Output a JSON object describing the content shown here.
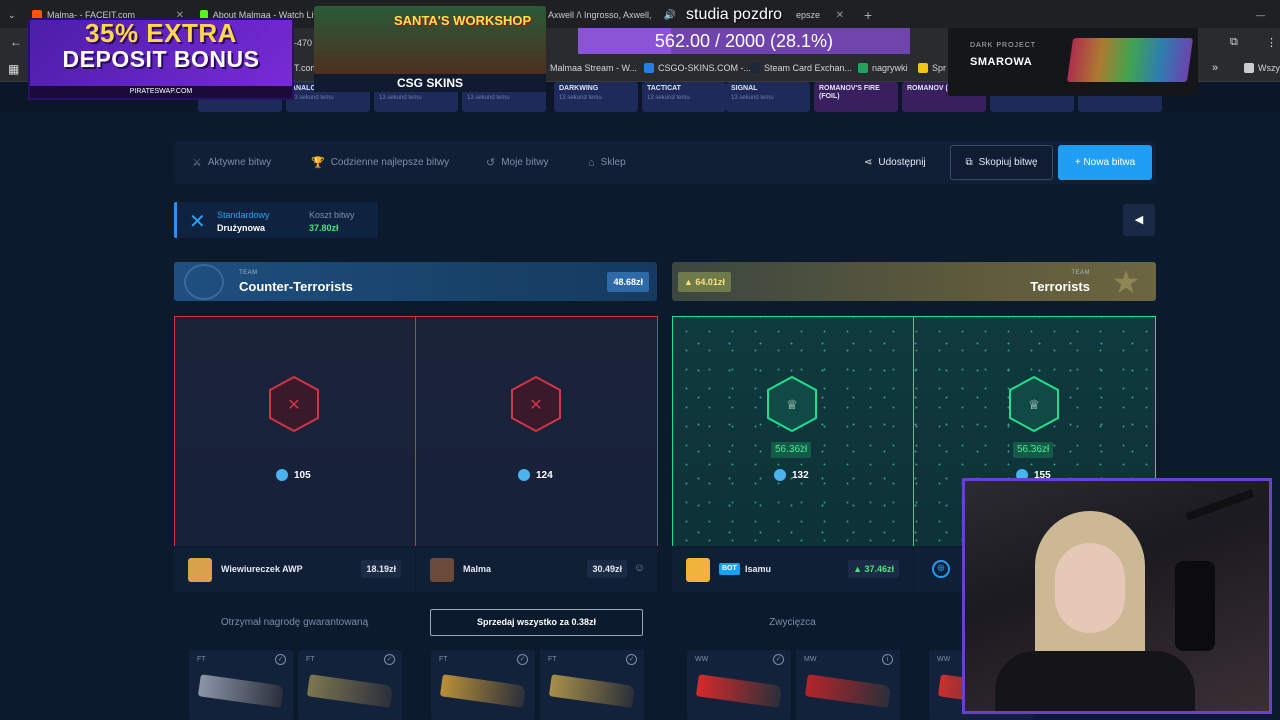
{
  "browser": {
    "tabs": [
      {
        "title": "Malma- - FACEIT.com",
        "color": "#ff5500"
      },
      {
        "title": "About Malmaa - Watch Liv",
        "color": "#53fc18"
      },
      {
        "title": "Axwell /\\ Ingrosso, Axwell,",
        "color": "#ff0000"
      },
      {
        "title": "epsze",
        "color": "#2a8ff0"
      }
    ],
    "url_partial": "T.com",
    "url_fragment": "-470",
    "bookmarks": [
      {
        "label": "Malmaa Stream - W..."
      },
      {
        "label": "CSGO-SKINS.COM -..."
      },
      {
        "label": "Steam Card Exchan..."
      },
      {
        "label": "nagrywki"
      },
      {
        "label": "Spr"
      },
      {
        "label": "Wszy"
      }
    ]
  },
  "overlay": {
    "promo_line1": "35% EXTRA",
    "promo_line2": "DEPOSIT BONUS",
    "promo_site": "PIRATESWAP.COM",
    "santa_title": "SANTA'S WORKSHOP",
    "sponsor": "CSG SKINS",
    "stream_title": "studia pozdro",
    "goal_text": "562.00 / 2000 (28.1%)",
    "goal_fraction": 0.281,
    "kb_brand": "DARK PROJECT",
    "kb_name": "SMAROWA"
  },
  "battle_strip": [
    {
      "name": "",
      "sub": "13 sekund temu"
    },
    {
      "name": "ANALOG INPUT",
      "sub": "13 sekund temu"
    },
    {
      "name": "SIGNAL",
      "sub": "13 sekund temu"
    },
    {
      "name": "DARKWING",
      "sub": "13 sekund temu"
    },
    {
      "name": "DARKWING",
      "sub": "13 sekund temu"
    },
    {
      "name": "TACTICAT",
      "sub": "13 sekund temu"
    },
    {
      "name": "SIGNAL",
      "sub": "13 sekund temu"
    },
    {
      "name": "ROMANOV'S FIRE (FOIL)",
      "sub": ""
    },
    {
      "name": "ROMANOV (FOIL)",
      "sub": ""
    },
    {
      "name": "",
      "sub": "12 sekund temu"
    },
    {
      "name": "",
      "sub": "12 sekund temu"
    }
  ],
  "nav": {
    "active_battles": "Aktywne bitwy",
    "daily_best": "Codzienne najlepsze bitwy",
    "my_battles": "Moje bitwy",
    "shop": "Sklep",
    "share": "Udostępnij",
    "copy_battle": "Skopiuj bitwę",
    "new_battle": "+ Nowa bitwa"
  },
  "mode": {
    "type": "Standardowy",
    "variant": "Drużynowa",
    "cost_label": "Koszt bitwy",
    "cost_value": "37.80zł"
  },
  "teams": {
    "label": "TEAM",
    "ct_name": "Counter-Terrorists",
    "ct_value": "48.68zł",
    "t_name": "Terrorists",
    "t_value": "▲ 64.01zł"
  },
  "slots": [
    {
      "coins": "105",
      "win_value": ""
    },
    {
      "coins": "124",
      "win_value": ""
    },
    {
      "coins": "132",
      "win_value": "56.36zł"
    },
    {
      "coins": "155",
      "win_value": "56.36zł"
    }
  ],
  "players": [
    {
      "name": "Wiewiureczek AWP",
      "value": "18.19zł",
      "avatar": "#d9a24a"
    },
    {
      "name": "Malma",
      "value": "30.49zł",
      "avatar": "#6b4a3a"
    },
    {
      "name": "Isamu",
      "value": "▲ 37.46zł",
      "avatar": "#f0b43a",
      "bot": "BOT"
    }
  ],
  "status": {
    "guaranteed": "Otrzymał nagrodę gwarantowaną",
    "sell_all": "Sprzedaj wszystko za 0.38zł",
    "winner": "Zwycięzca"
  },
  "items": [
    {
      "cond": "FT",
      "color": "#8c96a8"
    },
    {
      "cond": "FT",
      "color": "#7d7650"
    },
    {
      "cond": "FT",
      "color": "#b8903a"
    },
    {
      "cond": "FT",
      "color": "#a8904a"
    },
    {
      "cond": "WW",
      "color": "#d62a2a"
    },
    {
      "cond": "MW",
      "color": "#b5242a"
    },
    {
      "cond": "WW",
      "color": "#c93030"
    }
  ],
  "colors": {
    "accent": "#1e9ef5",
    "win": "#1fe08f",
    "lose": "#d13447"
  }
}
